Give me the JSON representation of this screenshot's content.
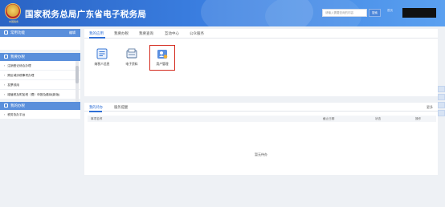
{
  "header": {
    "title": "国家税务总局广东省电子税务局",
    "emblem_caption": "中国税务",
    "search_placeholder": "请输入需要查询的内容",
    "search_button": "搜索",
    "small_link": "首页",
    "colors": {
      "bar": "#2a63c4",
      "accent": "#3a7ee0"
    }
  },
  "sidebar": {
    "common_functions": {
      "label": "常用功能",
      "action": "编辑"
    },
    "section_title": "我要办税",
    "items": [
      "注销登记综合办理",
      "跨区域涉税事项办理",
      "发票领用",
      "增值税及附加税（费）申报及缴纳(新版)"
    ],
    "section2_title": "我的办税",
    "items2": [
      "税务协办平台"
    ]
  },
  "main": {
    "tabs": [
      "我的应用",
      "我要办税",
      "我要查询",
      "互动中心",
      "公众服务"
    ],
    "tiles": [
      {
        "label": "纳税人信息",
        "icon": "taxpayer-info-icon"
      },
      {
        "label": "电子资料",
        "icon": "electronic-docs-icon"
      },
      {
        "label": "用户管理",
        "icon": "user-management-icon"
      }
    ]
  },
  "tasks": {
    "tabs": [
      "我的待办",
      "服务提醒"
    ],
    "more": "更多",
    "columns": [
      "事项名称",
      "截止日期",
      "状态",
      "操作"
    ],
    "empty_text": "暂无待办"
  }
}
